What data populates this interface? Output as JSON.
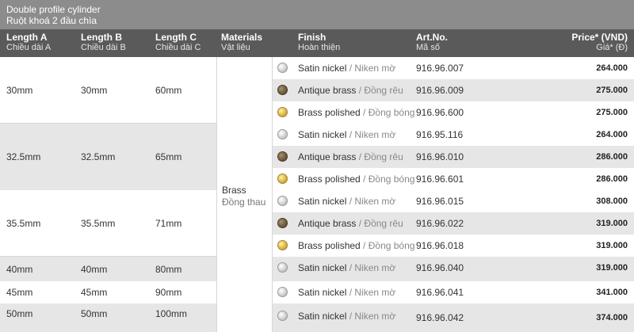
{
  "title": {
    "en": "Double profile cylinder",
    "vi": "Ruột khoá 2 đầu chìa"
  },
  "headers": {
    "length_a": {
      "en": "Length A",
      "vi": "Chiều dài A"
    },
    "length_b": {
      "en": "Length B",
      "vi": "Chiều dài B"
    },
    "length_c": {
      "en": "Length C",
      "vi": "Chiều dài C"
    },
    "materials": {
      "en": "Materials",
      "vi": "Vật liệu"
    },
    "finish": {
      "en": "Finish",
      "vi": "Hoàn thiện"
    },
    "artno": {
      "en": "Art.No.",
      "vi": "Mã số"
    },
    "price": {
      "en": "Price* (VND)",
      "vi": "Giá* (Đ)"
    }
  },
  "material": {
    "en": "Brass",
    "vi": "Đồng thau"
  },
  "dimensions": [
    {
      "a": "30mm",
      "b": "30mm",
      "c": "60mm"
    },
    {
      "a": "32.5mm",
      "b": "32.5mm",
      "c": "65mm"
    },
    {
      "a": "35.5mm",
      "b": "35.5mm",
      "c": "71mm"
    },
    {
      "a": "40mm",
      "b": "40mm",
      "c": "80mm"
    },
    {
      "a": "45mm",
      "b": "45mm",
      "c": "90mm"
    },
    {
      "a": "50mm",
      "b": "50mm",
      "c": "100mm"
    }
  ],
  "rows": [
    {
      "swatch": "satin-nickel-swatch",
      "finish_en": "Satin nickel",
      "finish_vi": "Niken mờ",
      "artno": "916.96.007",
      "price": "264.000"
    },
    {
      "swatch": "antique-brass-swatch",
      "finish_en": "Antique brass",
      "finish_vi": "Đồng rêu",
      "artno": "916.96.009",
      "price": "275.000"
    },
    {
      "swatch": "polished-brass-swatch",
      "finish_en": "Brass polished",
      "finish_vi": "Đồng bóng",
      "artno": "916.96.600",
      "price": "275.000"
    },
    {
      "swatch": "satin-nickel-swatch",
      "finish_en": "Satin nickel",
      "finish_vi": "Niken mờ",
      "artno": "916.95.116",
      "price": "264.000"
    },
    {
      "swatch": "antique-brass-swatch",
      "finish_en": "Antique brass",
      "finish_vi": "Đồng rêu",
      "artno": "916.96.010",
      "price": "286.000"
    },
    {
      "swatch": "polished-brass-swatch",
      "finish_en": "Brass polished",
      "finish_vi": "Đồng bóng",
      "artno": "916.96.601",
      "price": "286.000"
    },
    {
      "swatch": "satin-nickel-swatch",
      "finish_en": "Satin nickel",
      "finish_vi": "Niken mờ",
      "artno": "916.96.015",
      "price": "308.000"
    },
    {
      "swatch": "antique-brass-swatch",
      "finish_en": "Antique brass",
      "finish_vi": "Đồng rêu",
      "artno": "916.96.022",
      "price": "319.000"
    },
    {
      "swatch": "polished-brass-swatch",
      "finish_en": "Brass polished",
      "finish_vi": "Đồng bóng",
      "artno": "916.96.018",
      "price": "319.000"
    },
    {
      "swatch": "satin-nickel-swatch",
      "finish_en": "Satin nickel",
      "finish_vi": "Niken mờ",
      "artno": "916.96.040",
      "price": "319.000"
    },
    {
      "swatch": "satin-nickel-swatch",
      "finish_en": "Satin nickel",
      "finish_vi": "Niken mờ",
      "artno": "916.96.041",
      "price": "341.000"
    },
    {
      "swatch": "satin-nickel-swatch",
      "finish_en": "Satin nickel",
      "finish_vi": "Niken mờ",
      "artno": "916.96.042",
      "price": "374.000"
    }
  ],
  "colors": {
    "title_bg": "#8c8c8c",
    "header_bg": "#5a5a5a",
    "row_shade": "#e6e6e6"
  }
}
